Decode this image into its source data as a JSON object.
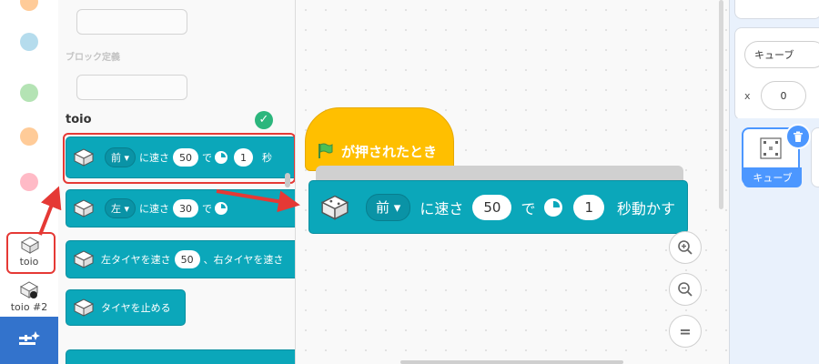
{
  "palette": {
    "category_title": "toio",
    "faded_label": "ブロック定義",
    "blocks": [
      {
        "direction": "前",
        "speed_label": "に速さ",
        "speed": "50",
        "unit_label": "で",
        "seconds": "1",
        "suffix": "秒"
      },
      {
        "direction": "左",
        "speed_label": "に速さ",
        "speed": "30",
        "unit_label": "で"
      },
      {
        "left_label": "左タイヤを速さ",
        "left_speed": "50",
        "right_label": "、右タイヤを速さ"
      },
      {
        "label": "タイヤを止める"
      }
    ]
  },
  "extensions": [
    {
      "label": "toio"
    },
    {
      "label": "toio #2",
      "badge": "2"
    }
  ],
  "workspace": {
    "hat_label": "が押されたとき",
    "block": {
      "direction": "前",
      "speed_label": "に速さ",
      "speed": "50",
      "unit_label": "で",
      "seconds": "1",
      "suffix": "秒動かす"
    },
    "zoom_reset_label": "="
  },
  "sprite_pane": {
    "sprite_name": "キューブ",
    "x_label": "x",
    "x_value": "0",
    "tile_label": "キューブ"
  },
  "colors": {
    "toio_block": "#0ba7ba",
    "hat_block": "#ffbf00",
    "highlight": "#e53935",
    "accent": "#4c97ff"
  }
}
